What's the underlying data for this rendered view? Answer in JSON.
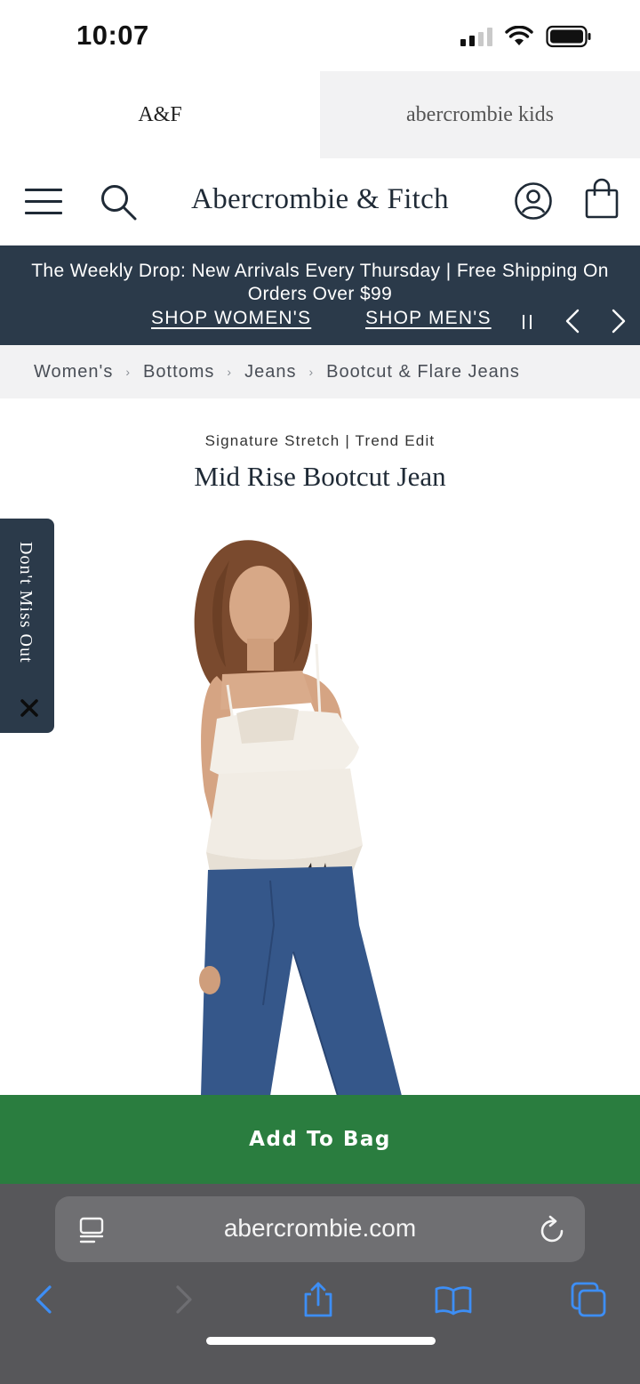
{
  "status_bar": {
    "time": "10:07"
  },
  "brand_tabs": [
    {
      "label": "A&F",
      "active": true
    },
    {
      "label": "abercrombie kids",
      "active": false
    }
  ],
  "header": {
    "logo": "Abercrombie & Fitch",
    "icons": [
      "menu-icon",
      "search-icon",
      "account-icon",
      "shopping-bag-icon"
    ]
  },
  "promo": {
    "text": "The Weekly Drop: New Arrivals Every Thursday | Free Shipping On Orders Over $99",
    "links": [
      "SHOP WOMEN'S",
      "SHOP MEN'S"
    ],
    "controls": [
      "pause-icon",
      "chevron-left-icon",
      "chevron-right-icon"
    ]
  },
  "breadcrumb": [
    "Women's",
    "Bottoms",
    "Jeans",
    "Bootcut & Flare Jeans"
  ],
  "product": {
    "subtitle": "Signature Stretch | Trend Edit",
    "title": "Mid Rise Bootcut Jean"
  },
  "side_tab": {
    "label": "Don't Miss Out"
  },
  "cta": {
    "add_to_bag": "Add To Bag"
  },
  "browser": {
    "url": "abercrombie.com",
    "toolbar": [
      "back-icon",
      "forward-icon",
      "share-icon",
      "bookmarks-icon",
      "tabs-icon"
    ]
  },
  "colors": {
    "navy": "#2b3a4a",
    "cta_green": "#2a7d3f",
    "breadcrumb_bg": "#f2f2f3",
    "browser_chrome": "#57575a",
    "ios_blue": "#3d8ef5"
  }
}
